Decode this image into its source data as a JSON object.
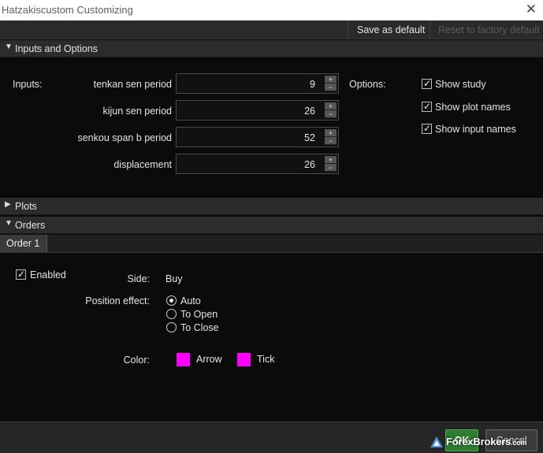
{
  "window": {
    "title": "Hatzakiscustom Customizing",
    "close_glyph": "✕"
  },
  "toolbar": {
    "save_default": "Save as default",
    "reset_factory": "Reset to factory default"
  },
  "sections": {
    "inputs": {
      "label": "Inputs and Options",
      "arrow": "⌄"
    },
    "plots": {
      "label": "Plots",
      "arrow": "›"
    },
    "orders": {
      "label": "Orders",
      "arrow": "⌄"
    }
  },
  "inputs": {
    "heading": "Inputs:",
    "fields": [
      {
        "label": "tenkan sen period",
        "value": "9"
      },
      {
        "label": "kijun sen period",
        "value": "26"
      },
      {
        "label": "senkou span b period",
        "value": "52"
      },
      {
        "label": "displacement",
        "value": "26"
      }
    ],
    "stepper_up": "+",
    "stepper_down": "−"
  },
  "options": {
    "heading": "Options:",
    "items": [
      {
        "label": "Show study",
        "checked": true
      },
      {
        "label": "Show plot names",
        "checked": true
      },
      {
        "label": "Show input names",
        "checked": true
      }
    ]
  },
  "orders": {
    "tab": "Order 1",
    "enabled": {
      "label": "Enabled",
      "checked": true
    },
    "side": {
      "label": "Side:",
      "value": "Buy"
    },
    "position_effect": {
      "label": "Position effect:",
      "options": [
        {
          "label": "Auto",
          "selected": true
        },
        {
          "label": "To Open",
          "selected": false
        },
        {
          "label": "To Close",
          "selected": false
        }
      ]
    },
    "color": {
      "label": "Color:",
      "arrow": {
        "label": "Arrow",
        "color": "#ff00ff"
      },
      "tick": {
        "label": "Tick",
        "color": "#ff00ff"
      }
    }
  },
  "footer": {
    "ok": "OK",
    "cancel": "Cancel"
  },
  "watermark": {
    "brand": "ForexBrokers",
    "domain": ".com"
  },
  "check_glyph": "✓"
}
